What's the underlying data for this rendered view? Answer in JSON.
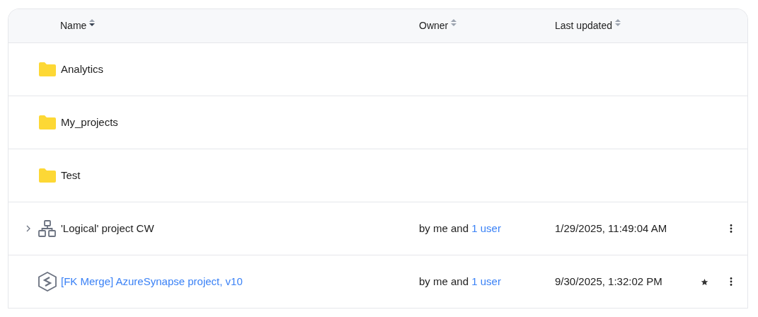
{
  "table": {
    "columns": [
      {
        "label": "Name",
        "sorted": true
      },
      {
        "label": "Owner",
        "sorted": false
      },
      {
        "label": "Last updated",
        "sorted": false
      }
    ],
    "rows": [
      {
        "kind": "folder",
        "name": "Analytics",
        "link": false
      },
      {
        "kind": "folder",
        "name": "My_projects",
        "link": false
      },
      {
        "kind": "folder",
        "name": "Test",
        "link": false
      },
      {
        "kind": "logical-model",
        "name": "'Logical' project CW",
        "link": false,
        "expanded": false,
        "owner": {
          "text": "by me and",
          "link": "1 user"
        },
        "updated": "1/29/2025, 11:49:04 AM",
        "starred": false
      },
      {
        "kind": "synapse",
        "name": "[FK Merge] AzureSynapse project, v10",
        "link": true,
        "owner": {
          "text": "by me and",
          "link": "1 user"
        },
        "updated": "9/30/2025, 1:32:02 PM",
        "starred": true
      }
    ]
  }
}
